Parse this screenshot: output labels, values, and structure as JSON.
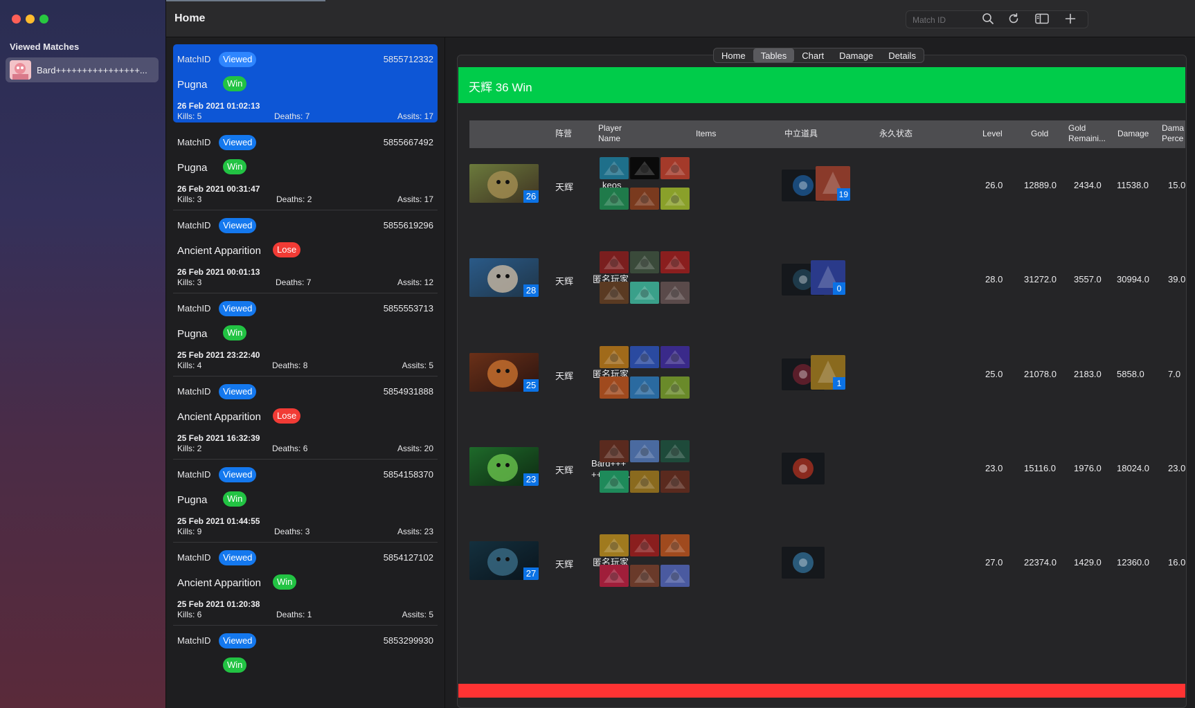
{
  "window": {
    "title": "Home"
  },
  "search": {
    "placeholder": "Match ID"
  },
  "sidebar": {
    "heading": "Viewed Matches",
    "items": [
      {
        "label": "Bard++++++++++++++++..."
      }
    ]
  },
  "match_list": [
    {
      "id_label": "MatchID",
      "status": "Viewed",
      "match_id": "5855712332",
      "hero": "Pugna",
      "result": "Win",
      "date": "26 Feb 2021 01:02:13",
      "kills": "Kills: 5",
      "deaths": "Deaths: 7",
      "assists": "Assits: 17",
      "selected": true
    },
    {
      "id_label": "MatchID",
      "status": "Viewed",
      "match_id": "5855667492",
      "hero": "Pugna",
      "result": "Win",
      "date": "26 Feb 2021 00:31:47",
      "kills": "Kills: 3",
      "deaths": "Deaths: 2",
      "assists": "Assits: 17",
      "selected": false
    },
    {
      "id_label": "MatchID",
      "status": "Viewed",
      "match_id": "5855619296",
      "hero": "Ancient Apparition",
      "result": "Lose",
      "date": "26 Feb 2021 00:01:13",
      "kills": "Kills: 3",
      "deaths": "Deaths: 7",
      "assists": "Assits: 12",
      "selected": false
    },
    {
      "id_label": "MatchID",
      "status": "Viewed",
      "match_id": "5855553713",
      "hero": "Pugna",
      "result": "Win",
      "date": "25 Feb 2021 23:22:40",
      "kills": "Kills: 4",
      "deaths": "Deaths: 8",
      "assists": "Assits: 5",
      "selected": false
    },
    {
      "id_label": "MatchID",
      "status": "Viewed",
      "match_id": "5854931888",
      "hero": "Ancient Apparition",
      "result": "Lose",
      "date": "25 Feb 2021 16:32:39",
      "kills": "Kills: 2",
      "deaths": "Deaths: 6",
      "assists": "Assits: 20",
      "selected": false
    },
    {
      "id_label": "MatchID",
      "status": "Viewed",
      "match_id": "5854158370",
      "hero": "Pugna",
      "result": "Win",
      "date": "25 Feb 2021 01:44:55",
      "kills": "Kills: 9",
      "deaths": "Deaths: 3",
      "assists": "Assits: 23",
      "selected": false
    },
    {
      "id_label": "MatchID",
      "status": "Viewed",
      "match_id": "5854127102",
      "hero": "Ancient Apparition",
      "result": "Win",
      "date": "25 Feb 2021 01:20:38",
      "kills": "Kills: 6",
      "deaths": "Deaths: 1",
      "assists": "Assits: 5",
      "selected": false
    },
    {
      "id_label": "MatchID",
      "status": "Viewed",
      "match_id": "5853299930",
      "hero": "",
      "result": "Win",
      "date": "",
      "kills": "",
      "deaths": "",
      "assists": "",
      "selected": false
    }
  ],
  "tabs": [
    {
      "label": "Home",
      "active": false
    },
    {
      "label": "Tables",
      "active": true
    },
    {
      "label": "Chart",
      "active": false
    },
    {
      "label": "Damage",
      "active": false
    },
    {
      "label": "Details",
      "active": false
    }
  ],
  "result_banner": {
    "text": "天辉  36  Win",
    "color": "#00cc4a"
  },
  "bottom_banner": {
    "color": "#ff3333"
  },
  "table": {
    "headers": {
      "faction": "阵营",
      "player_name_1": "Player",
      "player_name_2": "Name",
      "items": "Items",
      "neutral": "中立道具",
      "buffs": "永久状态",
      "level": "Level",
      "gold": "Gold",
      "gold_remaining_1": "Gold",
      "gold_remaining_2": "Remaini...",
      "damage": "Damage",
      "damage_pct_1": "Dama",
      "damage_pct_2": "Perce"
    },
    "rows": [
      {
        "hero_icon": "pudge-portrait",
        "hero_level": "26",
        "faction": "天辉",
        "player": "keos",
        "items": [
          "item-1",
          "item-2",
          "item-3",
          "item-4",
          "item-5",
          "item-6"
        ],
        "neutral_icon": "neutral-item",
        "buff_count": "19",
        "level": "26.0",
        "gold": "12889.0",
        "gold_remaining": "2434.0",
        "damage": "11538.0",
        "damage_pct": "15.0"
      },
      {
        "hero_icon": "sniper-portrait",
        "hero_level": "28",
        "faction": "天辉",
        "player": "匿名玩家",
        "items": [
          "item-1",
          "item-2",
          "item-3",
          "item-4",
          "item-5",
          "item-6"
        ],
        "neutral_icon": "neutral-item",
        "buff_count": "0",
        "level": "28.0",
        "gold": "31272.0",
        "gold_remaining": "3557.0",
        "damage": "30994.0",
        "damage_pct": "39.0"
      },
      {
        "hero_icon": "monkey-king-portrait",
        "hero_level": "25",
        "faction": "天辉",
        "player": "匿名玩家",
        "items": [
          "item-1",
          "item-2",
          "item-3",
          "item-4",
          "item-5",
          "item-6"
        ],
        "neutral_icon": "neutral-item",
        "buff_count": "1",
        "level": "25.0",
        "gold": "21078.0",
        "gold_remaining": "2183.0",
        "damage": "5858.0",
        "damage_pct": "7.0"
      },
      {
        "hero_icon": "pugna-portrait",
        "hero_level": "23",
        "faction": "天辉",
        "player": "Bard+++\n++++++...",
        "items": [
          "item-1",
          "item-2",
          "item-3",
          "item-4",
          "item-5",
          "item-6"
        ],
        "neutral_icon": "neutral-item",
        "buff_count": "",
        "level": "23.0",
        "gold": "15116.0",
        "gold_remaining": "1976.0",
        "damage": "18024.0",
        "damage_pct": "23.0"
      },
      {
        "hero_icon": "phantom-assassin-portrait",
        "hero_level": "27",
        "faction": "天辉",
        "player": "匿名玩家",
        "items": [
          "item-1",
          "item-2",
          "item-3",
          "item-4",
          "item-5",
          "item-6"
        ],
        "neutral_icon": "neutral-item",
        "buff_count": "",
        "level": "27.0",
        "gold": "22374.0",
        "gold_remaining": "1429.0",
        "damage": "12360.0",
        "damage_pct": "16.0"
      }
    ]
  }
}
